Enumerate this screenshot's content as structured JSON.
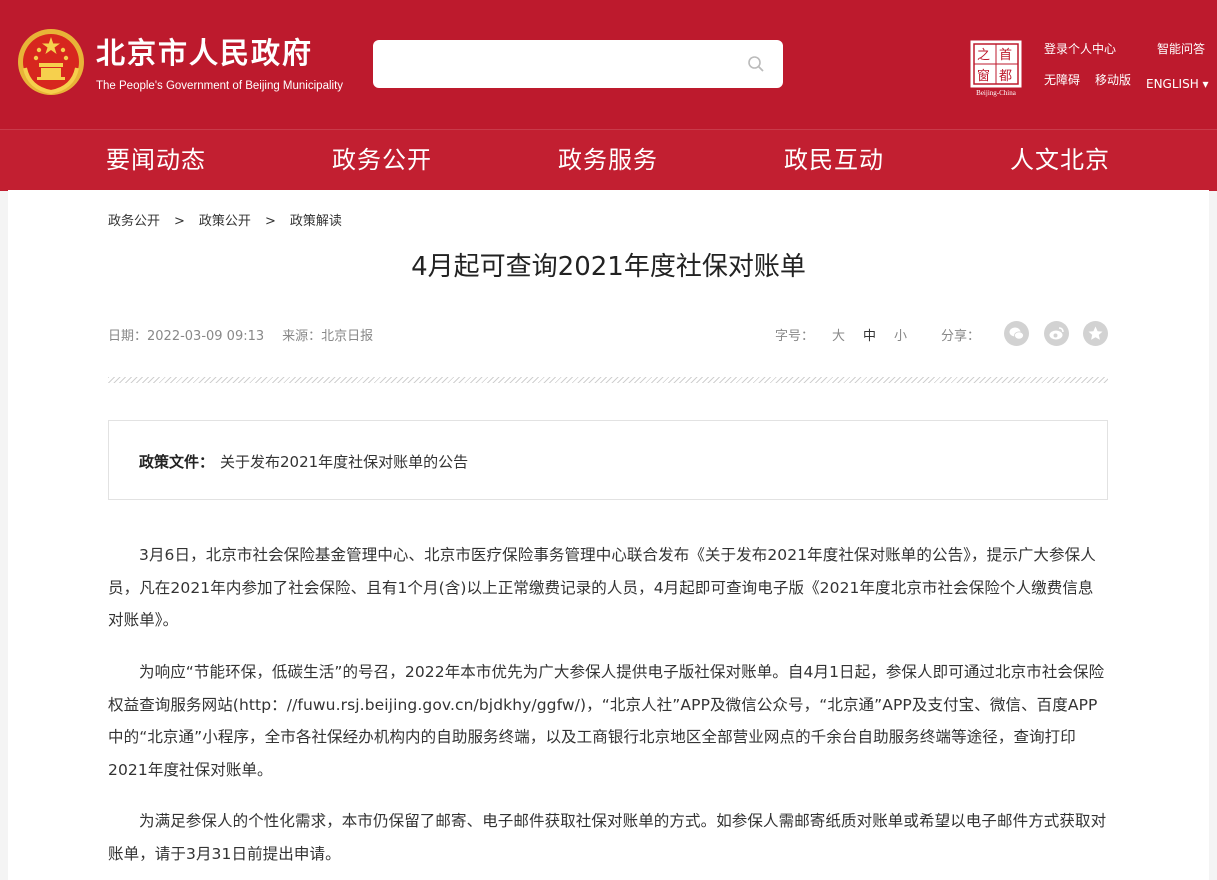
{
  "header": {
    "site_title": "北京市人民政府",
    "site_subtitle": "The People's Government of Beijing Municipality",
    "search_placeholder": "",
    "badge_chars": [
      "之",
      "首",
      "窗",
      "都"
    ],
    "badge_caption": "Beijing-China",
    "links": {
      "login": "登录个人中心",
      "qa": "智能问答",
      "accessible": "无障碍",
      "mobile": "移动版",
      "english": "ENGLISH ▾"
    }
  },
  "nav": [
    "要闻动态",
    "政务公开",
    "政务服务",
    "政民互动",
    "人文北京"
  ],
  "breadcrumb": [
    "政务公开",
    "政策公开",
    "政策解读"
  ],
  "breadcrumb_sep": ">",
  "article": {
    "title": "4月起可查询2021年度社保对账单",
    "date": "日期：2022-03-09 09:13",
    "source": "来源：北京日报",
    "font_size_label": "字号：",
    "font_sizes": [
      "大",
      "中",
      "小"
    ],
    "share_label": "分享：",
    "policy_label": "政策文件：",
    "policy_doc": "关于发布2021年度社保对账单的公告",
    "paragraphs": [
      "3月6日，北京市社会保险基金管理中心、北京市医疗保险事务管理中心联合发布《关于发布2021年度社保对账单的公告》，提示广大参保人员，凡在2021年内参加了社会保险、且有1个月(含)以上正常缴费记录的人员，4月起即可查询电子版《2021年度北京市社会保险个人缴费信息对账单》。",
      "为响应“节能环保，低碳生活”的号召，2022年本市优先为广大参保人提供电子版社保对账单。自4月1日起，参保人即可通过北京市社会保险权益查询服务网站(http：//fuwu.rsj.beijing.gov.cn/bjdkhy/ggfw/)，“北京人社”APP及微信公众号，“北京通”APP及支付宝、微信、百度APP中的“北京通”小程序，全市各社保经办机构内的自助服务终端，以及工商银行北京地区全部营业网点的千余台自助服务终端等途径，查询打印2021年度社保对账单。",
      "为满足参保人的个性化需求，本市仍保留了邮寄、电子邮件获取社保对账单的方式。如参保人需邮寄纸质对账单或希望以电子邮件方式获取对账单，请于3月31日前提出申请。"
    ]
  },
  "colors": {
    "header_red": "#bd1a2d",
    "nav_red": "#c21f31",
    "emblem_gold": "#f3c24b"
  },
  "icons": [
    "national-emblem-icon",
    "search-icon",
    "wechat-icon",
    "weibo-icon",
    "favorite-star-icon"
  ]
}
